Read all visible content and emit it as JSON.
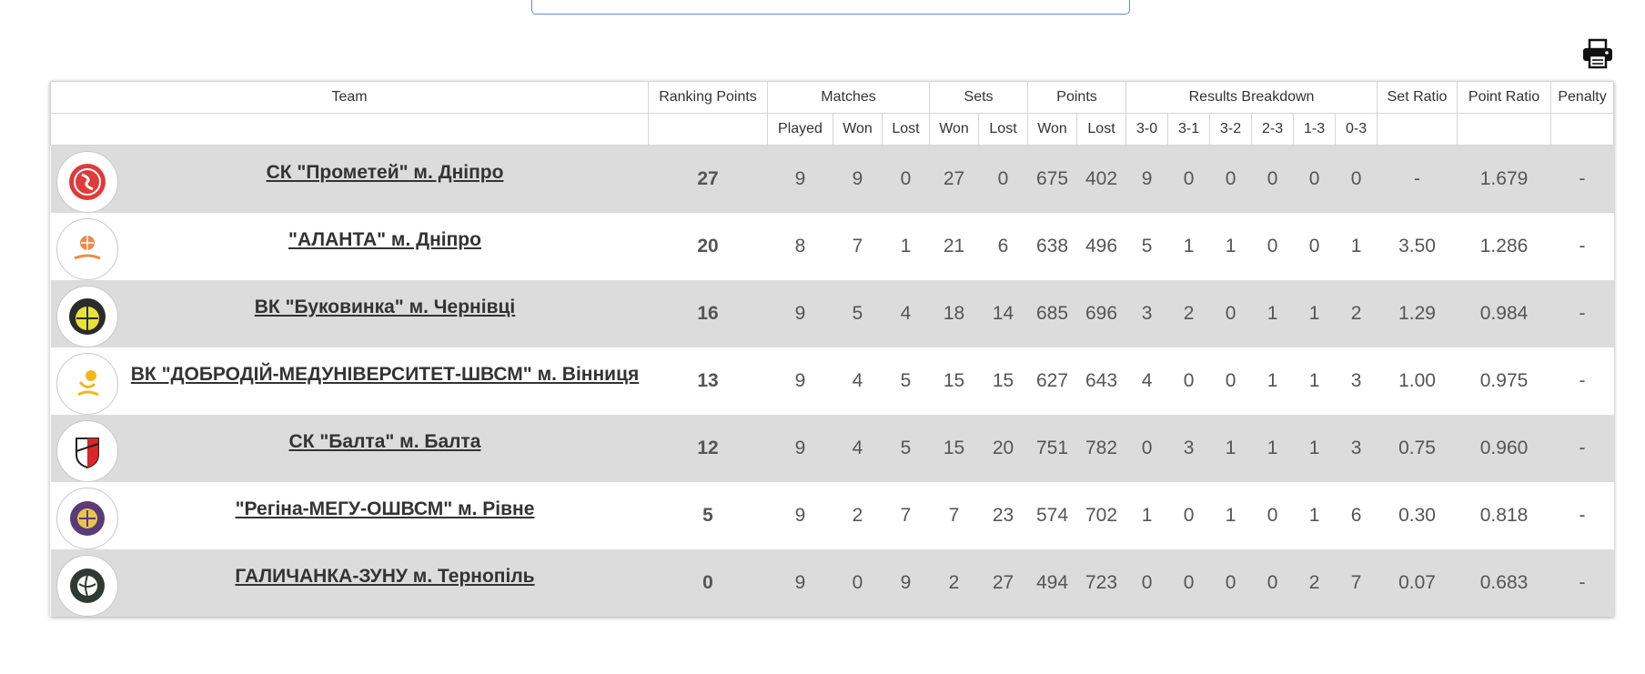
{
  "columns": {
    "team": "Team",
    "ranking_points": "Ranking Points",
    "matches": "Matches",
    "sets": "Sets",
    "points": "Points",
    "results_breakdown": "Results Breakdown",
    "set_ratio": "Set Ratio",
    "point_ratio": "Point Ratio",
    "penalty": "Penalty",
    "played": "Played",
    "won": "Won",
    "lost": "Lost",
    "r30": "3-0",
    "r31": "3-1",
    "r32": "3-2",
    "r23": "2-3",
    "r13": "1-3",
    "r03": "0-3"
  },
  "rows": [
    {
      "team": "СК \"Прометей\" м. Дніпро",
      "rp": "27",
      "played": "9",
      "mw": "9",
      "ml": "0",
      "sw": "27",
      "sl": "0",
      "pw": "675",
      "pl": "402",
      "r30": "9",
      "r31": "0",
      "r32": "0",
      "r23": "0",
      "r13": "0",
      "r03": "0",
      "set_ratio": "-",
      "point_ratio": "1.679",
      "penalty": "-"
    },
    {
      "team": "\"АЛАНТА\" м. Дніпро",
      "rp": "20",
      "played": "8",
      "mw": "7",
      "ml": "1",
      "sw": "21",
      "sl": "6",
      "pw": "638",
      "pl": "496",
      "r30": "5",
      "r31": "1",
      "r32": "1",
      "r23": "0",
      "r13": "0",
      "r03": "1",
      "set_ratio": "3.50",
      "point_ratio": "1.286",
      "penalty": "-"
    },
    {
      "team": "ВК \"Буковинка\" м. Чернівці",
      "rp": "16",
      "played": "9",
      "mw": "5",
      "ml": "4",
      "sw": "18",
      "sl": "14",
      "pw": "685",
      "pl": "696",
      "r30": "3",
      "r31": "2",
      "r32": "0",
      "r23": "1",
      "r13": "1",
      "r03": "2",
      "set_ratio": "1.29",
      "point_ratio": "0.984",
      "penalty": "-"
    },
    {
      "team": "ВК \"ДОБРОДІЙ-МЕДУНІВЕРСИТЕТ-ШВСМ\" м. Вінниця",
      "rp": "13",
      "played": "9",
      "mw": "4",
      "ml": "5",
      "sw": "15",
      "sl": "15",
      "pw": "627",
      "pl": "643",
      "r30": "4",
      "r31": "0",
      "r32": "0",
      "r23": "1",
      "r13": "1",
      "r03": "3",
      "set_ratio": "1.00",
      "point_ratio": "0.975",
      "penalty": "-"
    },
    {
      "team": "СК \"Балта\" м. Балта",
      "rp": "12",
      "played": "9",
      "mw": "4",
      "ml": "5",
      "sw": "15",
      "sl": "20",
      "pw": "751",
      "pl": "782",
      "r30": "0",
      "r31": "3",
      "r32": "1",
      "r23": "1",
      "r13": "1",
      "r03": "3",
      "set_ratio": "0.75",
      "point_ratio": "0.960",
      "penalty": "-"
    },
    {
      "team": "\"Регіна-МЕГУ-ОШВСМ\" м. Рівне",
      "rp": "5",
      "played": "9",
      "mw": "2",
      "ml": "7",
      "sw": "7",
      "sl": "23",
      "pw": "574",
      "pl": "702",
      "r30": "1",
      "r31": "0",
      "r32": "1",
      "r23": "0",
      "r13": "1",
      "r03": "6",
      "set_ratio": "0.30",
      "point_ratio": "0.818",
      "penalty": "-"
    },
    {
      "team": "ГАЛИЧАНКА-ЗУНУ м. Тернопіль",
      "rp": "0",
      "played": "9",
      "mw": "0",
      "ml": "9",
      "sw": "2",
      "sl": "27",
      "pw": "494",
      "pl": "723",
      "r30": "0",
      "r31": "0",
      "r32": "0",
      "r23": "0",
      "r13": "2",
      "r03": "7",
      "set_ratio": "0.07",
      "point_ratio": "0.683",
      "penalty": "-"
    }
  ]
}
